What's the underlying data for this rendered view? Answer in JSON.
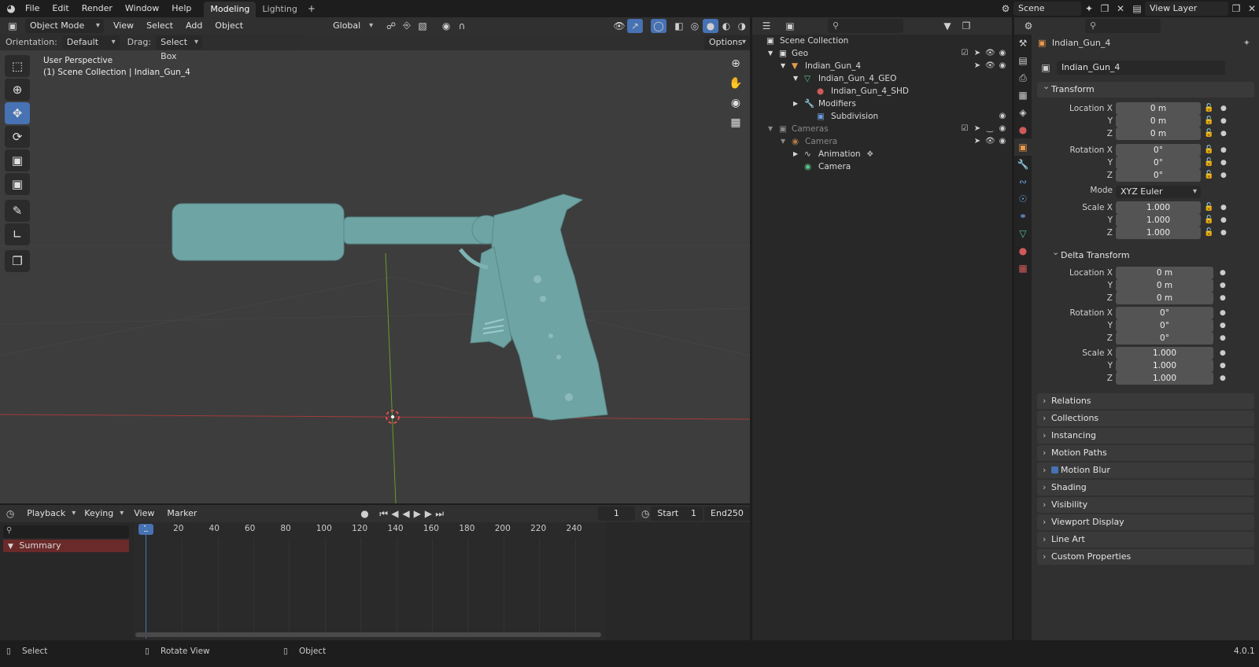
{
  "topbar": {
    "menus": [
      "File",
      "Edit",
      "Render",
      "Window",
      "Help"
    ],
    "workspaces": [
      "Modeling",
      "Lighting"
    ],
    "scene": "Scene",
    "view_layer": "View Layer"
  },
  "viewport": {
    "mode": "Object Mode",
    "menus": [
      "View",
      "Select",
      "Add",
      "Object"
    ],
    "transform_orientation": "Global",
    "orientation_label": "Orientation:",
    "orientation_value": "Default",
    "drag_label": "Drag:",
    "drag_value": "Select Box",
    "options_label": "Options",
    "overlay_line1": "User Perspective",
    "overlay_line2": "(1) Scene Collection | Indian_Gun_4"
  },
  "timeline": {
    "menus": [
      "Playback",
      "Keying",
      "View",
      "Marker"
    ],
    "current_frame": "1",
    "start_label": "Start",
    "start_value": "1",
    "end_label": "End",
    "end_value": "250",
    "ruler": [
      "1",
      "20",
      "40",
      "60",
      "80",
      "100",
      "120",
      "140",
      "160",
      "180",
      "200",
      "220",
      "240"
    ],
    "summary": "Summary"
  },
  "outliner": {
    "rows": [
      {
        "label": "Scene Collection"
      },
      {
        "label": "Geo"
      },
      {
        "label": "Indian_Gun_4"
      },
      {
        "label": "Indian_Gun_4_GEO"
      },
      {
        "label": "Indian_Gun_4_SHD"
      },
      {
        "label": "Modifiers"
      },
      {
        "label": "Subdivision"
      },
      {
        "label": "Cameras"
      },
      {
        "label": "Camera"
      },
      {
        "label": "Animation"
      },
      {
        "label": "Camera"
      }
    ]
  },
  "properties": {
    "object_name": "Indian_Gun_4",
    "datablock_name": "Indian_Gun_4",
    "transform_title": "Transform",
    "delta_title": "Delta Transform",
    "mode_label": "Mode",
    "mode_value": "XYZ Euler",
    "transform": [
      {
        "label": "Location X",
        "value": "0 m"
      },
      {
        "label": "Y",
        "value": "0 m"
      },
      {
        "label": "Z",
        "value": "0 m"
      },
      {
        "label": "Rotation X",
        "value": "0°"
      },
      {
        "label": "Y",
        "value": "0°"
      },
      {
        "label": "Z",
        "value": "0°"
      },
      {
        "label": "Scale X",
        "value": "1.000"
      },
      {
        "label": "Y",
        "value": "1.000"
      },
      {
        "label": "Z",
        "value": "1.000"
      }
    ],
    "delta": [
      {
        "label": "Location X",
        "value": "0 m"
      },
      {
        "label": "Y",
        "value": "0 m"
      },
      {
        "label": "Z",
        "value": "0 m"
      },
      {
        "label": "Rotation X",
        "value": "0°"
      },
      {
        "label": "Y",
        "value": "0°"
      },
      {
        "label": "Z",
        "value": "0°"
      },
      {
        "label": "Scale X",
        "value": "1.000"
      },
      {
        "label": "Y",
        "value": "1.000"
      },
      {
        "label": "Z",
        "value": "1.000"
      }
    ],
    "panels": [
      "Relations",
      "Collections",
      "Instancing",
      "Motion Paths",
      "Motion Blur",
      "Shading",
      "Visibility",
      "Viewport Display",
      "Line Art",
      "Custom Properties"
    ]
  },
  "statusbar": {
    "select": "Select",
    "rotate": "Rotate View",
    "object": "Object",
    "version": "4.0.1"
  },
  "colors": {
    "accent": "#4772b3",
    "model": "#6fa4a4",
    "x_axis": "#a23b3b",
    "y_axis": "#6b9a2a"
  }
}
